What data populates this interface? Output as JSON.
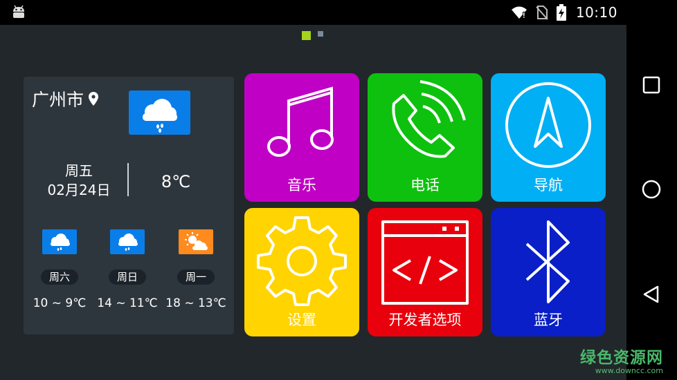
{
  "status_bar": {
    "time": "10:10"
  },
  "pager": {
    "pages": 2,
    "current": 1
  },
  "weather": {
    "city": "广州市",
    "weekday": "周五",
    "date": "02月24日",
    "temperature": "8℃",
    "current_icon": "cloud-rain-icon",
    "forecast": [
      {
        "day": "周六",
        "range": "10 ~ 9℃",
        "icon": "cloud-rain-icon"
      },
      {
        "day": "周日",
        "range": "14 ~ 11℃",
        "icon": "cloud-rain-icon"
      },
      {
        "day": "周一",
        "range": "18 ~ 13℃",
        "icon": "sun-cloud-icon"
      }
    ]
  },
  "apps": [
    {
      "label": "音乐",
      "icon": "music-note-icon",
      "color": "#c000c4"
    },
    {
      "label": "电话",
      "icon": "phone-icon",
      "color": "#0ec10e"
    },
    {
      "label": "导航",
      "icon": "compass-arrow-icon",
      "color": "#00aff4"
    },
    {
      "label": "设置",
      "icon": "gear-icon",
      "color": "#ffd400"
    },
    {
      "label": "开发者选项",
      "icon": "code-window-icon",
      "color": "#e8000c"
    },
    {
      "label": "蓝牙",
      "icon": "bluetooth-icon",
      "color": "#0a1fc7"
    }
  ],
  "watermark": {
    "title": "绿色资源网",
    "url": "www.downcc.com"
  },
  "colors": {
    "screen_bg": "#22272b",
    "weather_card": "#2e363d",
    "weather_icon_blue": "#0a7ee8",
    "weather_icon_orange": "#ff8a1e",
    "pager_active": "#a6d21c"
  }
}
